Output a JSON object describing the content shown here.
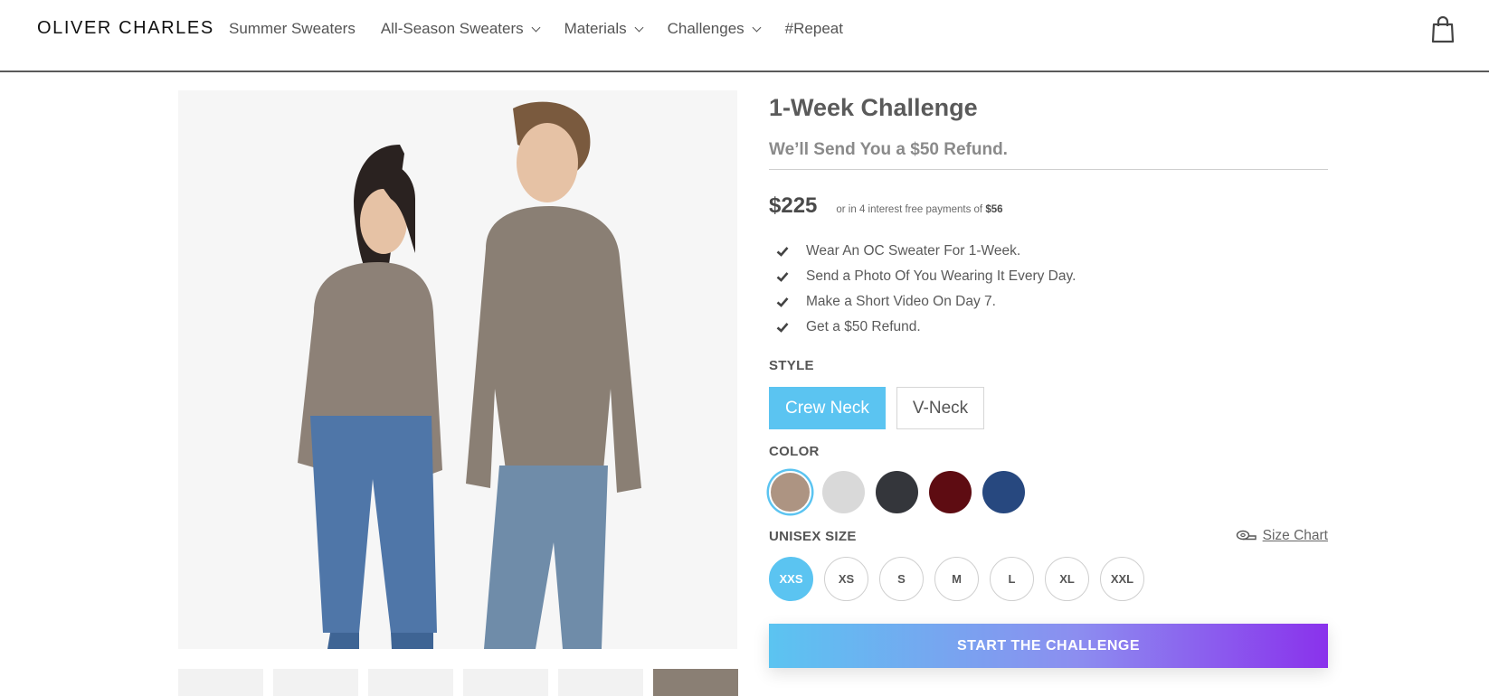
{
  "brand": {
    "name": "OLIVER CHARLES"
  },
  "nav": {
    "items": [
      {
        "label": "Summer Sweaters",
        "has_dropdown": false
      },
      {
        "label": "All-Season Sweaters",
        "has_dropdown": true
      },
      {
        "label": "Materials",
        "has_dropdown": true
      },
      {
        "label": "Challenges",
        "has_dropdown": true
      },
      {
        "label": "#Repeat",
        "has_dropdown": false
      }
    ],
    "cart_icon": "shopping-bag-icon"
  },
  "product": {
    "title": "1-Week Challenge",
    "subtitle": "We’ll Send You a $50 Refund.",
    "price": "$225",
    "installments_text": "or in 4 interest free payments of",
    "installments_amount": "$56",
    "features": [
      "Wear An OC Sweater For 1-Week.",
      "Send a Photo Of You Wearing It Every Day.",
      "Make a Short Video On Day 7.",
      "Get a $50 Refund."
    ]
  },
  "style": {
    "label": "STYLE",
    "options": [
      "Crew Neck",
      "V-Neck"
    ],
    "selected": "Crew Neck"
  },
  "color": {
    "label": "COLOR",
    "swatches": [
      {
        "name": "oatmeal",
        "hex": "#ad9482",
        "selected": true
      },
      {
        "name": "light-gray",
        "hex": "#d9d9d9",
        "selected": false
      },
      {
        "name": "charcoal",
        "hex": "#34363b",
        "selected": false
      },
      {
        "name": "burgundy",
        "hex": "#5e0c12",
        "selected": false
      },
      {
        "name": "navy",
        "hex": "#27487f",
        "selected": false
      }
    ]
  },
  "size": {
    "label": "UNISEX SIZE",
    "chart_link": "Size Chart",
    "options": [
      "XXS",
      "XS",
      "S",
      "M",
      "L",
      "XL",
      "XXL"
    ],
    "selected": "XXS"
  },
  "cta": {
    "label": "START THE CHALLENGE"
  },
  "colors": {
    "accent": "#5bc4f1",
    "gradient_end": "#8a32ec",
    "text": "#5a5a5a"
  }
}
